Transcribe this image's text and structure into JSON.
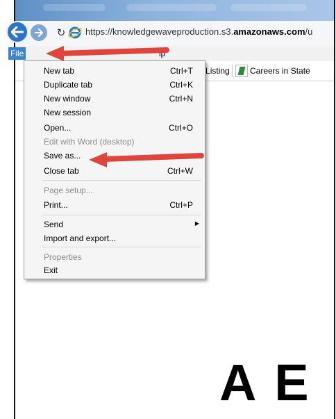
{
  "browser": {
    "url_prefix": "https://knowledgewaveproduction.s3.",
    "url_domain": "amazonaws.com",
    "url_suffix": "/u"
  },
  "menubar": {
    "file_label": "File",
    "help_label": "lp"
  },
  "favorites": {
    "item1": "ent Listing",
    "item2": "Careers in State"
  },
  "file_menu": {
    "new_tab": {
      "label": "New tab",
      "shortcut": "Ctrl+T"
    },
    "duplicate_tab": {
      "label": "Duplicate tab",
      "shortcut": "Ctrl+K"
    },
    "new_window": {
      "label": "New window",
      "shortcut": "Ctrl+N"
    },
    "new_session": {
      "label": "New session"
    },
    "open": {
      "label": "Open...",
      "shortcut": "Ctrl+O"
    },
    "edit_with_word": {
      "label": "Edit with Word (desktop)"
    },
    "save_as": {
      "label": "Save as..."
    },
    "close_tab": {
      "label": "Close tab",
      "shortcut": "Ctrl+W"
    },
    "page_setup": {
      "label": "Page setup..."
    },
    "print": {
      "label": "Print...",
      "shortcut": "Ctrl+P"
    },
    "send": {
      "label": "Send"
    },
    "import_export": {
      "label": "Import and export..."
    },
    "properties": {
      "label": "Properties"
    },
    "exit": {
      "label": "Exit"
    }
  },
  "page": {
    "heading_fragment": "A E"
  },
  "colors": {
    "menu_highlight": "#3c84d3",
    "arrow": "#e0453d",
    "disabled_text": "#8c8c8c"
  }
}
